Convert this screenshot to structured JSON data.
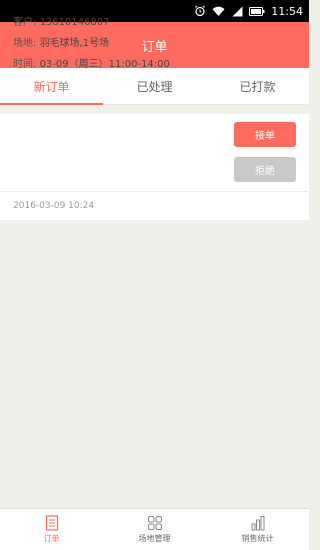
{
  "status_bar": {
    "time": "11:54"
  },
  "app_bar": {
    "title": "订单"
  },
  "tabs": [
    {
      "label": "新订单",
      "active": true
    },
    {
      "label": "已处理",
      "active": false
    },
    {
      "label": "已打款",
      "active": false
    }
  ],
  "order": {
    "customer_label": "客户:",
    "customer_value": "13610146807",
    "venue_label": "场地:",
    "venue_value": "羽毛球场,1号场",
    "time_label": "时间:",
    "time_value": "03-09（周三）11:00-14:00",
    "accept_label": "接单",
    "reject_label": "拒绝",
    "created_at": "2016-03-09 10:24"
  },
  "bottom_nav": [
    {
      "label": "订单",
      "icon": "document-icon",
      "active": true
    },
    {
      "label": "场地管理",
      "icon": "grid-icon",
      "active": false
    },
    {
      "label": "销售统计",
      "icon": "bar-chart-icon",
      "active": false
    }
  ],
  "colors": {
    "accent": "#ff6b5e",
    "reject": "#c9c9c9",
    "background": "#f0f0ea"
  }
}
